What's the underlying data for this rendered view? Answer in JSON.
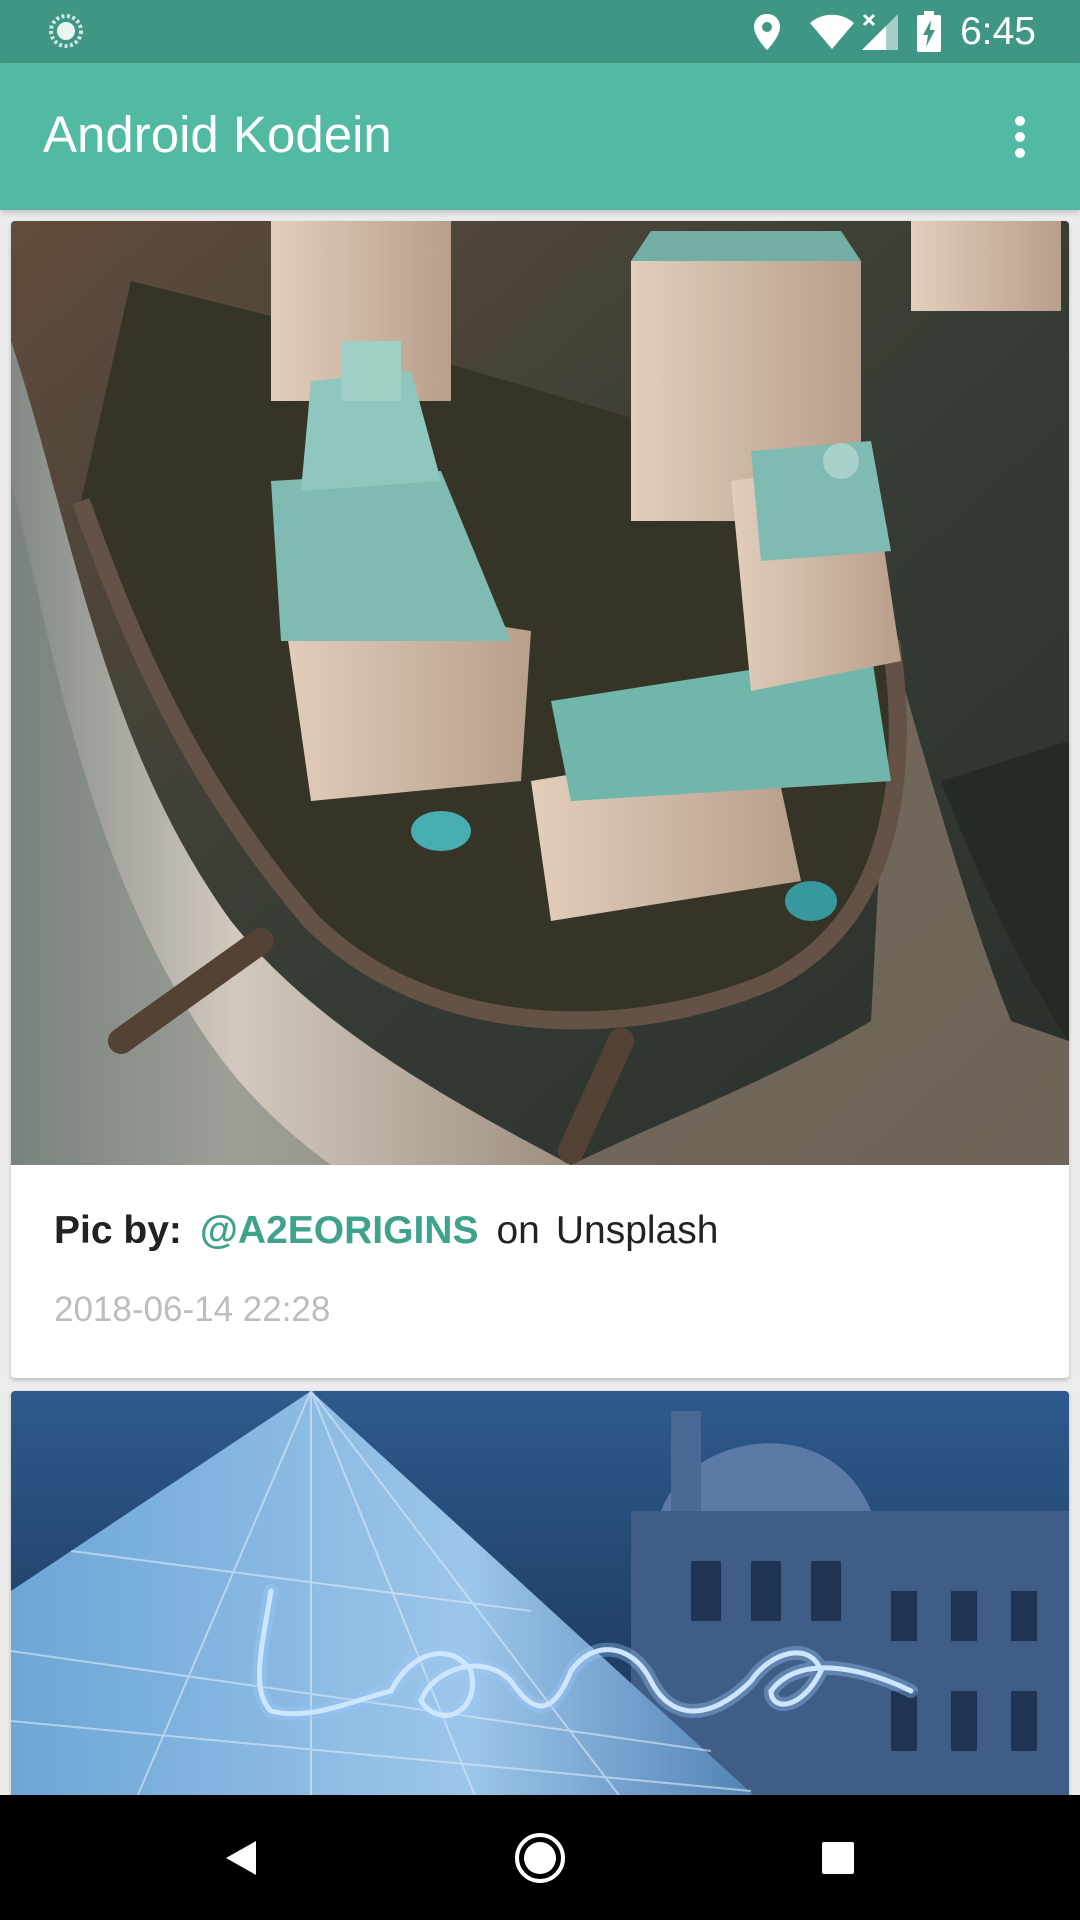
{
  "status_bar": {
    "time": "6:45",
    "icons": [
      "loading-spinner-icon",
      "location-icon",
      "wifi-icon",
      "signal-no-data-icon",
      "battery-charging-icon"
    ]
  },
  "app_bar": {
    "title": "Android Kodein",
    "overflow_icon": "more-vert-icon"
  },
  "posts": [
    {
      "pic_by_label": "Pic by:",
      "username": "@A2EORIGINS",
      "on_label": "on",
      "source": "Unsplash",
      "date": "2018-06-14 22:28"
    },
    {
      "pic_by_label": "",
      "username": "",
      "on_label": "",
      "source": "",
      "date": ""
    }
  ],
  "nav_bar": {
    "buttons": [
      "back-icon",
      "home-icon",
      "recents-icon"
    ]
  },
  "colors": {
    "status_bar": "#3F9684",
    "app_bar": "#52B9A3",
    "accent": "#3FA28C",
    "date_text": "#BDBDBD"
  }
}
